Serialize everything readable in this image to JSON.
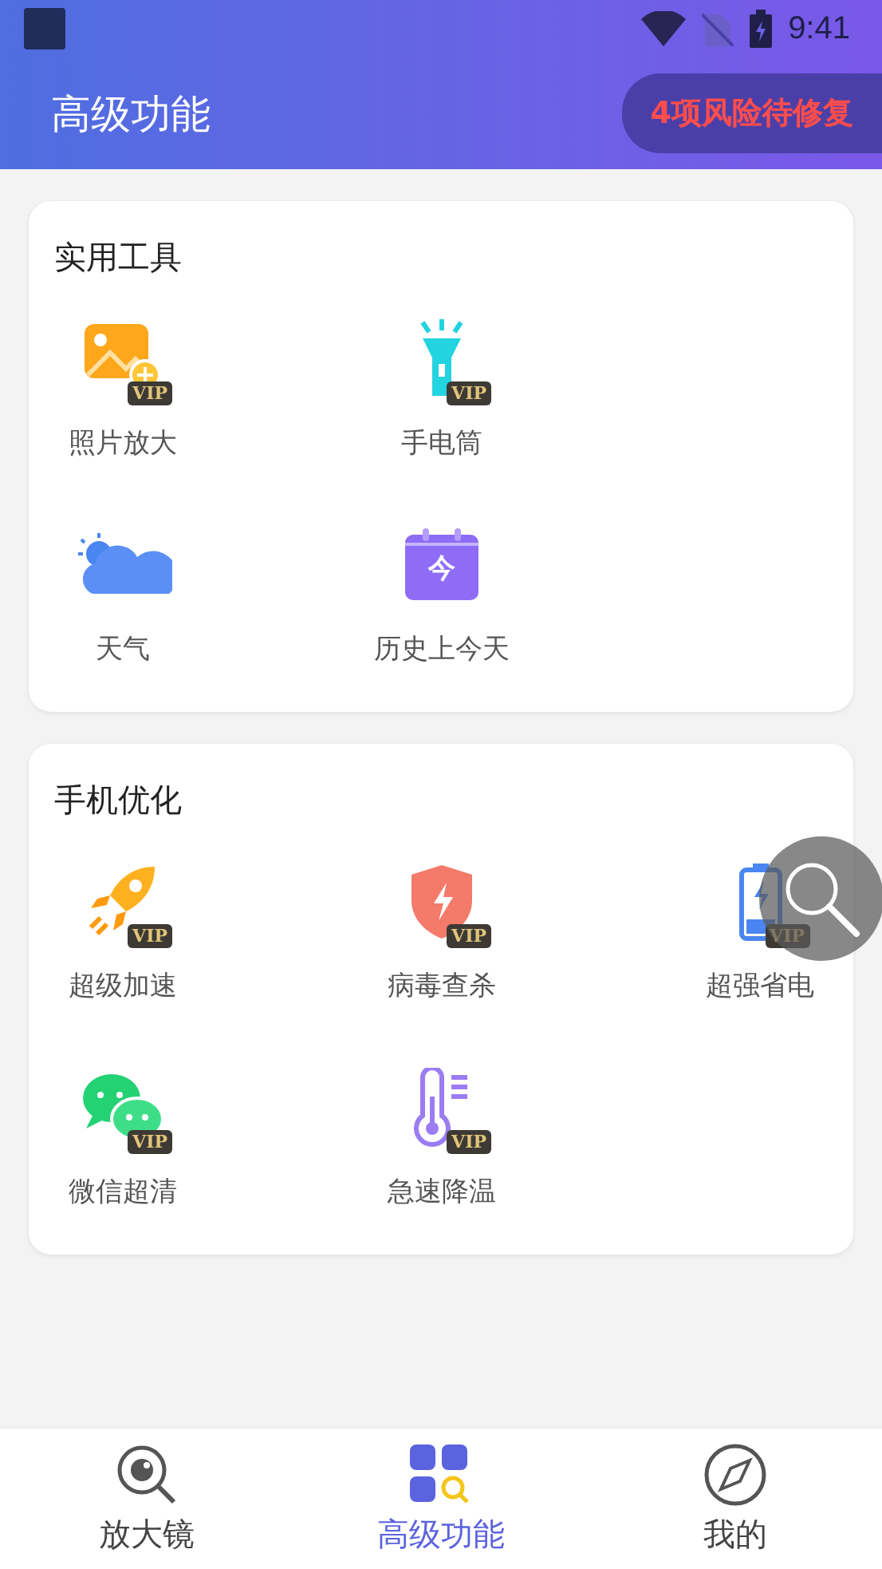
{
  "status_bar": {
    "time": "9:41"
  },
  "header": {
    "title": "高级功能",
    "badge": "4项风险待修复"
  },
  "sections": [
    {
      "title": "实用工具",
      "rows": [
        [
          {
            "kind": "photo",
            "label": "照片放大",
            "badge": "VIP"
          },
          {
            "kind": "flashlight",
            "label": "手电筒",
            "badge": "VIP"
          }
        ],
        [
          {
            "kind": "weather",
            "label": "天气"
          },
          {
            "kind": "calendar",
            "label": "历史上今天",
            "icon_text": "今"
          }
        ]
      ]
    },
    {
      "title": "手机优化",
      "rows": [
        [
          {
            "kind": "rocket",
            "label": "超级加速",
            "badge": "VIP"
          },
          {
            "kind": "shield",
            "label": "病毒查杀",
            "badge": "VIP"
          },
          {
            "kind": "battery",
            "label": "超强省电",
            "badge": "VIP"
          }
        ],
        [
          {
            "kind": "chat",
            "label": "微信超清",
            "badge": "VIP"
          },
          {
            "kind": "thermometer",
            "label": "急速降温",
            "badge": "VIP"
          }
        ]
      ]
    }
  ],
  "tabs": [
    {
      "kind": "magnifier",
      "label": "放大镜",
      "selected": false
    },
    {
      "kind": "features",
      "label": "高级功能",
      "selected": true
    },
    {
      "kind": "compass",
      "label": "我的",
      "selected": false
    }
  ]
}
